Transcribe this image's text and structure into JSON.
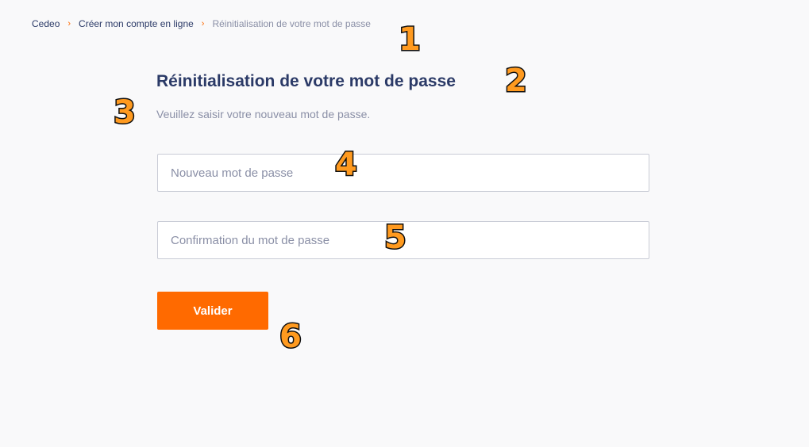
{
  "breadcrumb": {
    "items": [
      "Cedeo",
      "Créer mon compte en ligne",
      "Réinitialisation de votre mot de passe"
    ],
    "separator": "›"
  },
  "page": {
    "title": "Réinitialisation de votre mot de passe",
    "subtitle": "Veuillez saisir votre nouveau mot de passe."
  },
  "form": {
    "new_password": {
      "value": "",
      "placeholder": "Nouveau mot de passe"
    },
    "confirm_password": {
      "value": "",
      "placeholder": "Confirmation du mot de passe"
    },
    "submit_label": "Valider"
  },
  "annotations": [
    "1",
    "2",
    "3",
    "4",
    "5",
    "6"
  ],
  "colors": {
    "accent": "#ff6a00",
    "title": "#2b3a67",
    "muted": "#8a8fa6",
    "background": "#f9f9fa",
    "marker_fill": "#ff9a1f"
  }
}
